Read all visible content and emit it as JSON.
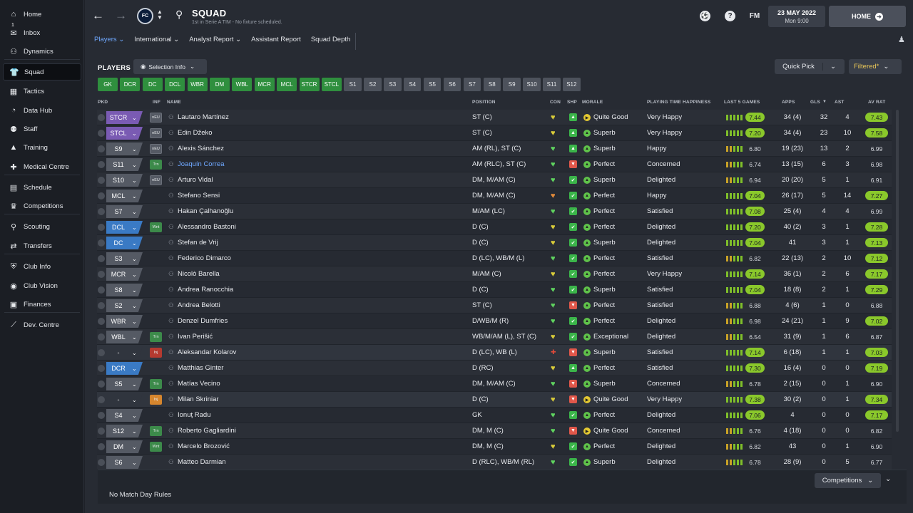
{
  "sidebar": {
    "items": [
      {
        "label": "Home",
        "icon": "home-icon"
      },
      {
        "label": "Inbox",
        "icon": "inbox-icon",
        "badge": "1"
      },
      {
        "label": "Dynamics",
        "icon": "dynamics-icon"
      },
      {
        "label": "Squad",
        "icon": "squad-icon",
        "active": true
      },
      {
        "label": "Tactics",
        "icon": "tactics-icon"
      },
      {
        "label": "Data Hub",
        "icon": "data-hub-icon"
      },
      {
        "label": "Staff",
        "icon": "staff-icon"
      },
      {
        "label": "Training",
        "icon": "training-icon"
      },
      {
        "label": "Medical Centre",
        "icon": "medical-icon"
      },
      {
        "label": "Schedule",
        "icon": "schedule-icon"
      },
      {
        "label": "Competitions",
        "icon": "trophy-icon"
      },
      {
        "label": "Scouting",
        "icon": "scouting-icon"
      },
      {
        "label": "Transfers",
        "icon": "transfers-icon"
      },
      {
        "label": "Club Info",
        "icon": "club-info-icon"
      },
      {
        "label": "Club Vision",
        "icon": "club-vision-icon"
      },
      {
        "label": "Finances",
        "icon": "finances-icon"
      },
      {
        "label": "Dev. Centre",
        "icon": "dev-centre-icon"
      }
    ]
  },
  "header": {
    "title": "SQUAD",
    "subtitle": "1st in Serie A TIM - No fixture scheduled.",
    "date": "23 MAY 2022",
    "time": "Mon 9:00",
    "home_label": "HOME",
    "fm_label": "FM",
    "help_label": "?"
  },
  "subnav": {
    "tabs": [
      "Players",
      "International",
      "Analyst Report",
      "Assistant Report",
      "Squad Depth"
    ]
  },
  "toolbar": {
    "players_label": "PLAYERS",
    "selection_info": "Selection Info",
    "quick_pick": "Quick Pick",
    "filtered": "Filtered*"
  },
  "positions": {
    "starters": [
      "GK",
      "DCR",
      "DC",
      "DCL",
      "WBR",
      "DM",
      "WBL",
      "MCR",
      "MCL",
      "STCR",
      "STCL"
    ],
    "subs": [
      "S1",
      "S2",
      "S3",
      "S4",
      "S5",
      "S6",
      "S7",
      "S8",
      "S9",
      "S10",
      "S11",
      "S12"
    ]
  },
  "columns": {
    "pkd": "PKD",
    "inf": "INF",
    "name": "NAME",
    "position": "POSITION",
    "con": "CON",
    "shp": "SHP",
    "morale": "MORALE",
    "pth": "PLAYING TIME HAPPINESS",
    "last5": "LAST 5 GAMES",
    "apps": "APPS",
    "gls": "GLS",
    "ast": "AST",
    "avrat": "AV RAT"
  },
  "players": [
    {
      "role": "STCR",
      "rtype": "att",
      "inf": "nEU",
      "name": "Lautaro Martínez",
      "position": "ST (C)",
      "con": "yellow",
      "shp": "up",
      "morale": "Quite Good",
      "mtype": "qg",
      "pth": "Very Happy",
      "last5": "7.44",
      "l5g": true,
      "apps": "34 (4)",
      "gls": "32",
      "ast": "4",
      "av": "7.43",
      "avg": true
    },
    {
      "role": "STCL",
      "rtype": "att",
      "inf": "nEU",
      "name": "Edin Džeko",
      "position": "ST (C)",
      "con": "yellow",
      "shp": "up",
      "morale": "Superb",
      "mtype": "sup",
      "pth": "Very Happy",
      "last5": "7.20",
      "l5g": true,
      "apps": "34 (4)",
      "gls": "23",
      "ast": "10",
      "av": "7.58",
      "avg": true
    },
    {
      "role": "S9",
      "rtype": "sub",
      "inf": "nEU",
      "name": "Alexis Sánchez",
      "position": "AM (RL), ST (C)",
      "con": "green",
      "shp": "up",
      "morale": "Superb",
      "mtype": "sup",
      "pth": "Happy",
      "last5": "6.80",
      "l5g": false,
      "apps": "19 (23)",
      "gls": "13",
      "ast": "2",
      "av": "6.99",
      "avg": false
    },
    {
      "role": "S11",
      "rtype": "sub",
      "inf": "Trn",
      "name": "Joaquín Correa",
      "position": "AM (RLC), ST (C)",
      "con": "green",
      "shp": "down",
      "morale": "Perfect",
      "mtype": "per",
      "pth": "Concerned",
      "last5": "6.74",
      "l5g": false,
      "apps": "13 (15)",
      "gls": "6",
      "ast": "3",
      "av": "6.98",
      "avg": false,
      "link": true
    },
    {
      "role": "S10",
      "rtype": "sub",
      "inf": "nEU",
      "name": "Arturo Vidal",
      "position": "DM, M/AM (C)",
      "con": "green",
      "shp": "check",
      "morale": "Superb",
      "mtype": "sup",
      "pth": "Delighted",
      "last5": "6.94",
      "l5g": false,
      "apps": "20 (20)",
      "gls": "5",
      "ast": "1",
      "av": "6.91",
      "avg": false
    },
    {
      "role": "MCL",
      "rtype": "sub",
      "inf": "",
      "name": "Stefano Sensi",
      "position": "DM, M/AM (C)",
      "con": "orange",
      "shp": "check",
      "morale": "Perfect",
      "mtype": "per",
      "pth": "Happy",
      "last5": "7.04",
      "l5g": true,
      "apps": "26 (17)",
      "gls": "5",
      "ast": "14",
      "av": "7.27",
      "avg": true
    },
    {
      "role": "S7",
      "rtype": "sub",
      "inf": "",
      "name": "Hakan Çalhanoğlu",
      "position": "M/AM (LC)",
      "con": "green",
      "shp": "check",
      "morale": "Perfect",
      "mtype": "per",
      "pth": "Satisfied",
      "last5": "7.08",
      "l5g": true,
      "apps": "25 (4)",
      "gls": "4",
      "ast": "4",
      "av": "6.99",
      "avg": false
    },
    {
      "role": "DCL",
      "rtype": "def",
      "inf": "Wnt",
      "name": "Alessandro Bastoni",
      "position": "D (C)",
      "con": "yellow",
      "shp": "check",
      "morale": "Perfect",
      "mtype": "per",
      "pth": "Delighted",
      "last5": "7.20",
      "l5g": true,
      "apps": "40 (2)",
      "gls": "3",
      "ast": "1",
      "av": "7.28",
      "avg": true
    },
    {
      "role": "DC",
      "rtype": "def",
      "inf": "",
      "name": "Stefan de Vrij",
      "position": "D (C)",
      "con": "yellow",
      "shp": "check",
      "morale": "Superb",
      "mtype": "sup",
      "pth": "Delighted",
      "last5": "7.04",
      "l5g": true,
      "apps": "41",
      "gls": "3",
      "ast": "1",
      "av": "7.13",
      "avg": true
    },
    {
      "role": "S3",
      "rtype": "sub",
      "inf": "",
      "name": "Federico Dimarco",
      "position": "D (LC), WB/M (L)",
      "con": "green",
      "shp": "check",
      "morale": "Perfect",
      "mtype": "per",
      "pth": "Satisfied",
      "last5": "6.82",
      "l5g": false,
      "apps": "22 (13)",
      "gls": "2",
      "ast": "10",
      "av": "7.12",
      "avg": true
    },
    {
      "role": "MCR",
      "rtype": "sub",
      "inf": "",
      "name": "Nicolò Barella",
      "position": "M/AM (C)",
      "con": "yellow",
      "shp": "check",
      "morale": "Perfect",
      "mtype": "per",
      "pth": "Very Happy",
      "last5": "7.14",
      "l5g": true,
      "apps": "36 (1)",
      "gls": "2",
      "ast": "6",
      "av": "7.17",
      "avg": true
    },
    {
      "role": "S8",
      "rtype": "sub",
      "inf": "",
      "name": "Andrea Ranocchia",
      "position": "D (C)",
      "con": "green",
      "shp": "check",
      "morale": "Superb",
      "mtype": "sup",
      "pth": "Satisfied",
      "last5": "7.04",
      "l5g": true,
      "apps": "18 (8)",
      "gls": "2",
      "ast": "1",
      "av": "7.29",
      "avg": true
    },
    {
      "role": "S2",
      "rtype": "sub",
      "inf": "",
      "name": "Andrea Belotti",
      "position": "ST (C)",
      "con": "green",
      "shp": "down",
      "morale": "Perfect",
      "mtype": "per",
      "pth": "Satisfied",
      "last5": "6.88",
      "l5g": false,
      "apps": "4 (6)",
      "gls": "1",
      "ast": "0",
      "av": "6.88",
      "avg": false
    },
    {
      "role": "WBR",
      "rtype": "sub",
      "inf": "",
      "name": "Denzel Dumfries",
      "position": "D/WB/M (R)",
      "con": "green",
      "shp": "check",
      "morale": "Perfect",
      "mtype": "per",
      "pth": "Delighted",
      "last5": "6.98",
      "l5g": false,
      "apps": "24 (21)",
      "gls": "1",
      "ast": "9",
      "av": "7.02",
      "avg": true
    },
    {
      "role": "WBL",
      "rtype": "sub",
      "inf": "Trn",
      "name": "Ivan Perišić",
      "position": "WB/M/AM (L), ST (C)",
      "con": "yellow",
      "shp": "check",
      "morale": "Exceptional",
      "mtype": "per",
      "pth": "Delighted",
      "last5": "6.54",
      "l5g": false,
      "apps": "31 (9)",
      "gls": "1",
      "ast": "6",
      "av": "6.87",
      "avg": false
    },
    {
      "role": "-",
      "rtype": "none",
      "inf": "Inj",
      "name": "Aleksandar Kolarov",
      "position": "D (LC), WB (L)",
      "con": "injury",
      "shp": "down",
      "morale": "Superb",
      "mtype": "sup",
      "pth": "Satisfied",
      "last5": "7.14",
      "l5g": true,
      "apps": "6 (18)",
      "gls": "1",
      "ast": "1",
      "av": "7.03",
      "avg": true
    },
    {
      "role": "DCR",
      "rtype": "def",
      "inf": "",
      "name": "Matthias Ginter",
      "position": "D (RC)",
      "con": "yellow",
      "shp": "up",
      "morale": "Perfect",
      "mtype": "per",
      "pth": "Satisfied",
      "last5": "7.30",
      "l5g": true,
      "apps": "16 (4)",
      "gls": "0",
      "ast": "0",
      "av": "7.19",
      "avg": true
    },
    {
      "role": "S5",
      "rtype": "sub",
      "inf": "Trn",
      "name": "Matías Vecino",
      "position": "DM, M/AM (C)",
      "con": "green",
      "shp": "down",
      "morale": "Superb",
      "mtype": "sup",
      "pth": "Concerned",
      "last5": "6.78",
      "l5g": false,
      "apps": "2 (15)",
      "gls": "0",
      "ast": "1",
      "av": "6.90",
      "avg": false
    },
    {
      "role": "-",
      "rtype": "none",
      "inf": "Inj",
      "name": "Milan Skriniar",
      "position": "D (C)",
      "con": "yellow",
      "shp": "down",
      "morale": "Quite Good",
      "mtype": "qg",
      "pth": "Very Happy",
      "last5": "7.38",
      "l5g": true,
      "apps": "30 (2)",
      "gls": "0",
      "ast": "1",
      "av": "7.34",
      "avg": true
    },
    {
      "role": "S4",
      "rtype": "sub",
      "inf": "",
      "name": "Ionuţ Radu",
      "position": "GK",
      "con": "green",
      "shp": "check",
      "morale": "Perfect",
      "mtype": "per",
      "pth": "Delighted",
      "last5": "7.06",
      "l5g": true,
      "apps": "4",
      "gls": "0",
      "ast": "0",
      "av": "7.17",
      "avg": true
    },
    {
      "role": "S12",
      "rtype": "sub",
      "inf": "Trn",
      "name": "Roberto Gagliardini",
      "position": "DM, M (C)",
      "con": "green",
      "shp": "down",
      "morale": "Quite Good",
      "mtype": "qg",
      "pth": "Concerned",
      "last5": "6.76",
      "l5g": false,
      "apps": "4 (18)",
      "gls": "0",
      "ast": "0",
      "av": "6.82",
      "avg": false
    },
    {
      "role": "DM",
      "rtype": "sub",
      "inf": "Wnt",
      "name": "Marcelo Brozović",
      "position": "DM, M (C)",
      "con": "yellow",
      "shp": "check",
      "morale": "Perfect",
      "mtype": "per",
      "pth": "Delighted",
      "last5": "6.82",
      "l5g": false,
      "apps": "43",
      "gls": "0",
      "ast": "1",
      "av": "6.90",
      "avg": false
    },
    {
      "role": "S6",
      "rtype": "sub",
      "inf": "",
      "name": "Matteo Darmian",
      "position": "D (RLC), WB/M (RL)",
      "con": "green",
      "shp": "check",
      "morale": "Superb",
      "mtype": "sup",
      "pth": "Delighted",
      "last5": "6.78",
      "l5g": false,
      "apps": "28 (9)",
      "gls": "0",
      "ast": "5",
      "av": "6.77",
      "avg": false
    }
  ],
  "footer": {
    "no_rules": "No Match Day Rules",
    "competitions": "Competitions"
  },
  "colors": {
    "accent": "#6fa8ff",
    "green": "#8ac82b",
    "attack": "#7a5bb3",
    "defence": "#3a7ac4",
    "filtered": "#e8c658"
  }
}
